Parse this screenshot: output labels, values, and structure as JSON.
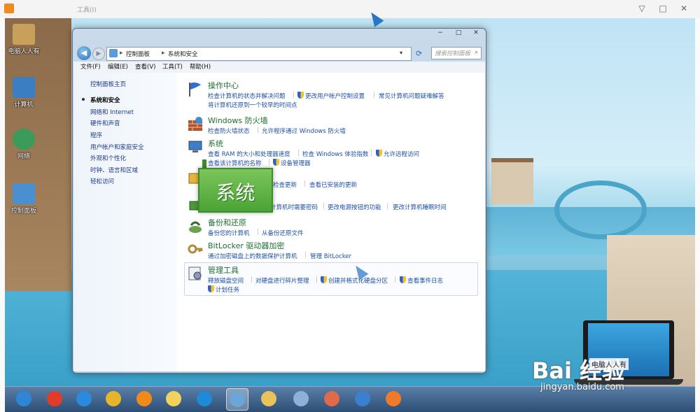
{
  "player": {
    "title": "工具(I)",
    "ctrl_min": "▽",
    "ctrl_max": "□",
    "ctrl_close": "✕"
  },
  "desktop_icons": [
    {
      "label": "电脑人人有",
      "color": "#c9a05a"
    },
    {
      "label": "计算机",
      "color": "#3b7fc2"
    },
    {
      "label": "网络",
      "color": "#3a9b5a"
    },
    {
      "label": "控制面板",
      "color": "#4a8fd0"
    }
  ],
  "window": {
    "caption_min": "−",
    "caption_max": "□",
    "caption_close": "✕",
    "breadcrumb": [
      "控制面板",
      "系统和安全"
    ],
    "search_placeholder": "搜索控制面板",
    "menu": [
      "文件(F)",
      "编辑(E)",
      "查看(V)",
      "工具(T)",
      "帮助(H)"
    ],
    "nav": [
      {
        "label": "控制面板主页",
        "current": false
      },
      {
        "label": "系统和安全",
        "current": true
      },
      {
        "label": "网络和 Internet",
        "current": false
      },
      {
        "label": "硬件和声音",
        "current": false
      },
      {
        "label": "程序",
        "current": false
      },
      {
        "label": "用户帐户和家庭安全",
        "current": false
      },
      {
        "label": "外观和个性化",
        "current": false
      },
      {
        "label": "时钟、语言和区域",
        "current": false
      },
      {
        "label": "轻松访问",
        "current": false
      }
    ],
    "categories": {
      "action_center": {
        "title": "操作中心",
        "l1": "检查计算机的状态并解决问题",
        "l2": "更改用户帐户控制设置",
        "l3": "常见计算机问题疑难解答",
        "l4": "将计算机还原到一个较早的时间点"
      },
      "firewall": {
        "title": "Windows 防火墙",
        "l1": "检查防火墙状态",
        "l2": "允许程序通过 Windows 防火墙"
      },
      "system": {
        "title": "系统",
        "l1": "查看 RAM 的大小和处理器速度",
        "l2": "检查 Windows 体验指数",
        "l3": "允许远程访问",
        "l4": "查看该计算机的名称",
        "l5": "设备管理器"
      },
      "update": {
        "l1": "检查更新",
        "l2": "查看已安装的更新"
      },
      "power": {
        "l1": "计算机时需要密码",
        "l2": "更改电源按钮的功能",
        "l3": "更改计算机睡眠时间"
      },
      "backup": {
        "title": "备份和还原",
        "l1": "备份您的计算机",
        "l2": "从备份还原文件"
      },
      "bitlocker": {
        "title": "BitLocker 驱动器加密",
        "l1": "通过加密磁盘上的数据保护计算机",
        "l2": "管理 BitLocker"
      },
      "admin": {
        "title": "管理工具",
        "l1": "释放磁盘空间",
        "l2": "对硬盘进行碎片整理",
        "l3": "创建并格式化硬盘分区",
        "l4": "查看事件日志",
        "l5": "计划任务"
      }
    }
  },
  "overlay": {
    "text": "系统"
  },
  "taskbar": {
    "buttons": [
      {
        "name": "start",
        "color": "#2f86d6"
      },
      {
        "name": "app-jiang",
        "color": "#e23b2a"
      },
      {
        "name": "ie",
        "color": "#2a8ae0"
      },
      {
        "name": "chrome",
        "color": "#e5b52c"
      },
      {
        "name": "media-player",
        "color": "#f08a1c"
      },
      {
        "name": "folder-yellow",
        "color": "#f1d25a"
      },
      {
        "name": "app-blue-ring",
        "color": "#1f8ad8"
      },
      {
        "name": "control-panel",
        "color": "#6aa6d8"
      },
      {
        "name": "explorer",
        "color": "#e9c35a"
      },
      {
        "name": "app-swirl",
        "color": "#8fb0d8"
      },
      {
        "name": "paint",
        "color": "#e06a4a"
      },
      {
        "name": "app-dots",
        "color": "#3a7fd0"
      },
      {
        "name": "app-orange",
        "color": "#f07a2a"
      }
    ]
  },
  "watermark": {
    "brand": "Bai 经验",
    "url": "jingyan.baidu.com",
    "sub": "电脑人人有"
  }
}
